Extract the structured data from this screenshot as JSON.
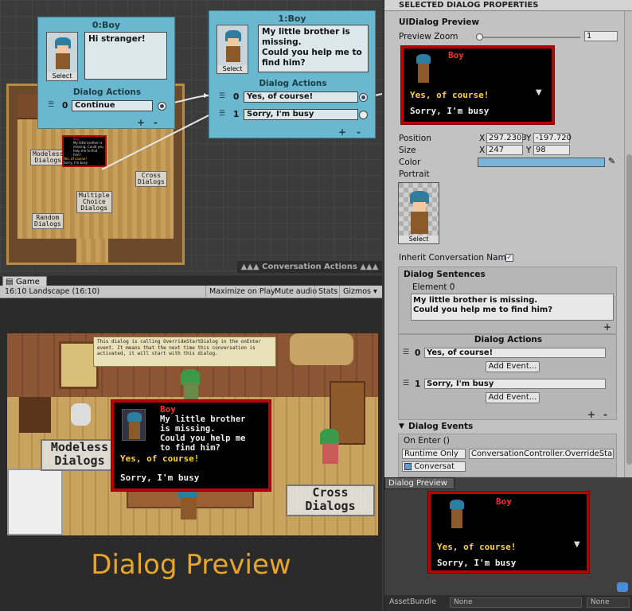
{
  "node_editor": {
    "node0": {
      "title": "0:Boy",
      "portrait_select": "Select",
      "text": "Hi stranger!",
      "actions_title": "Dialog Actions",
      "actions": [
        {
          "index": "0",
          "label": "Continue"
        }
      ]
    },
    "node1": {
      "title": "1:Boy",
      "portrait_select": "Select",
      "text": "My little brother is missing.\nCould you help me to find him?",
      "actions_title": "Dialog Actions",
      "actions": [
        {
          "index": "0",
          "label": "Yes, of course!"
        },
        {
          "index": "1",
          "label": "Sorry, I'm busy"
        }
      ]
    },
    "add": "+",
    "remove": "-",
    "map_labels": {
      "modeless": "Modeless\nDialogs",
      "cross": "Cross\nDialogs",
      "multiple": "Multiple\nChoice\nDialogs",
      "random": "Random\nDialogs"
    },
    "mini_dialog": {
      "name": "Boy",
      "text": "My little brother is missing. Could you help me to find him?",
      "option1": "Yes, of course!",
      "option2": "Sorry, I'm busy"
    },
    "conversation_actions": "▲▲▲ Conversation Actions ▲▲▲"
  },
  "game_view": {
    "tab": "Game",
    "aspect": "16:10 Landscape (16:10)",
    "toolbar": [
      "Maximize on Play",
      "Mute audio",
      "Stats",
      "Gizmos ▾"
    ],
    "note": "This dialog is calling OverrideStartDialog in the onEnter event. It means that the next time this conversation is activated, it will start with this dialog.",
    "labels": {
      "modeless": "Modeless\nDialogs",
      "cross": "Cross\nDialogs"
    },
    "dialog": {
      "name": "Boy",
      "text": "My little brother\nis missing.\nCould you help me\nto find him?",
      "option1": "Yes, of course!",
      "option2": "Sorry, I'm busy"
    },
    "caption": "Dialog Preview"
  },
  "inspector": {
    "header": "SELECTED DIALOG PROPERTIES",
    "title": "UIDialog Preview",
    "preview_zoom_label": "Preview Zoom",
    "preview_zoom_value": "1",
    "preview": {
      "name": "Boy",
      "option1": "Yes, of course!",
      "option2": "Sorry, I'm busy"
    },
    "position_label": "Position",
    "position_x": "297.2303",
    "position_y": "-197.720",
    "size_label": "Size",
    "size_x": "247",
    "size_y": "98",
    "x_label": "X",
    "y_label": "Y",
    "color_label": "Color",
    "color_value": "#78b4dc",
    "portrait_label": "Portrait",
    "portrait_select": "Select",
    "inherit_label": "Inherit Conversation Name",
    "inherit_checked": "✓",
    "sentences_title": "Dialog Sentences",
    "element_label": "Element 0",
    "element_text": "My little brother is missing.\nCould you help me to find him?",
    "actions_title": "Dialog Actions",
    "actions": [
      {
        "index": "0",
        "label": "Yes, of course!",
        "button": "Add Event..."
      },
      {
        "index": "1",
        "label": "Sorry, I'm busy",
        "button": "Add Event..."
      }
    ],
    "events_title": "Dialog Events",
    "on_enter": "On Enter ()",
    "runtime": "Runtime Only",
    "method": "ConversationController.OverrideStartD",
    "object_field": "Conversat",
    "add": "+",
    "remove": "-"
  },
  "dialog_preview_panel": {
    "tab": "Dialog Preview",
    "dialog": {
      "name": "Boy",
      "option1": "Yes, of course!",
      "option2": "Sorry, I'm busy"
    },
    "asset_bundle_label": "AssetBundle",
    "asset_bundle_value": "None",
    "variant_value": "None"
  }
}
